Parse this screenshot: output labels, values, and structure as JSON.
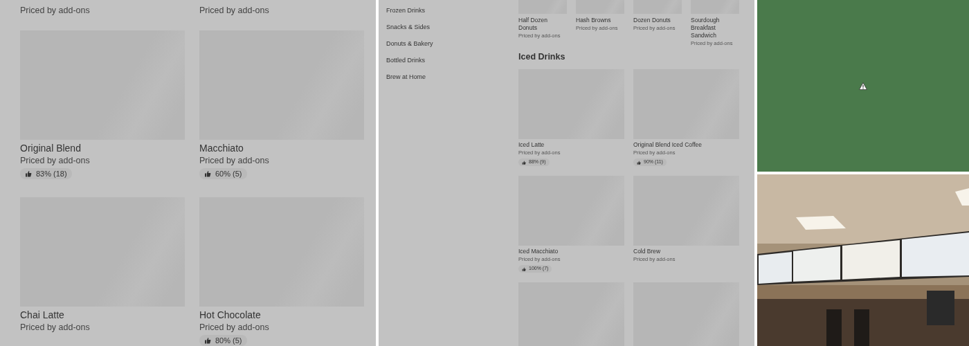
{
  "left_panel": {
    "items": [
      {
        "subtitle": "Priced by add-ons"
      },
      {
        "subtitle": "Priced by add-ons"
      },
      {
        "title": "Original Blend",
        "subtitle": "Priced by add-ons",
        "rating": "83% (18)"
      },
      {
        "title": "Macchiato",
        "subtitle": "Priced by add-ons",
        "rating": "60% (5)"
      },
      {
        "title": "Chai Latte",
        "subtitle": "Priced by add-ons"
      },
      {
        "title": "Hot Chocolate",
        "subtitle": "Priced by add-ons",
        "rating": "80% (5)"
      }
    ]
  },
  "middle_panel": {
    "sidebar": {
      "items": [
        "Frozen Drinks",
        "Snacks & Sides",
        "Donuts & Bakery",
        "Bottled Drinks",
        "Brew at Home"
      ]
    },
    "top_items": [
      {
        "title": "Half Dozen Donuts",
        "subtitle": "Priced by add-ons"
      },
      {
        "title": "Hash Browns",
        "subtitle": "Priced by add-ons"
      },
      {
        "title": "Dozen Donuts",
        "subtitle": "Priced by add-ons"
      },
      {
        "title": "Sourdough Breakfast Sandwich",
        "subtitle": "Priced by add-ons"
      }
    ],
    "section": {
      "heading": "Iced Drinks",
      "items": [
        {
          "kind": "product",
          "title": "Iced Latte",
          "subtitle": "Priced by add-ons",
          "rating": "88% (9)"
        },
        {
          "kind": "product",
          "title": "Original Blend Iced Coffee",
          "subtitle": "Priced by add-ons",
          "rating": "90% (11)"
        },
        {
          "kind": "product",
          "title": "Iced Macchiato",
          "subtitle": "Priced by add-ons",
          "rating": "100% (7)"
        },
        {
          "kind": "product",
          "title": "Cold Brew",
          "subtitle": "Priced by add-ons"
        },
        {
          "kind": "loading"
        },
        {
          "kind": "loading"
        }
      ]
    }
  },
  "right_top": {
    "kind": "error"
  }
}
